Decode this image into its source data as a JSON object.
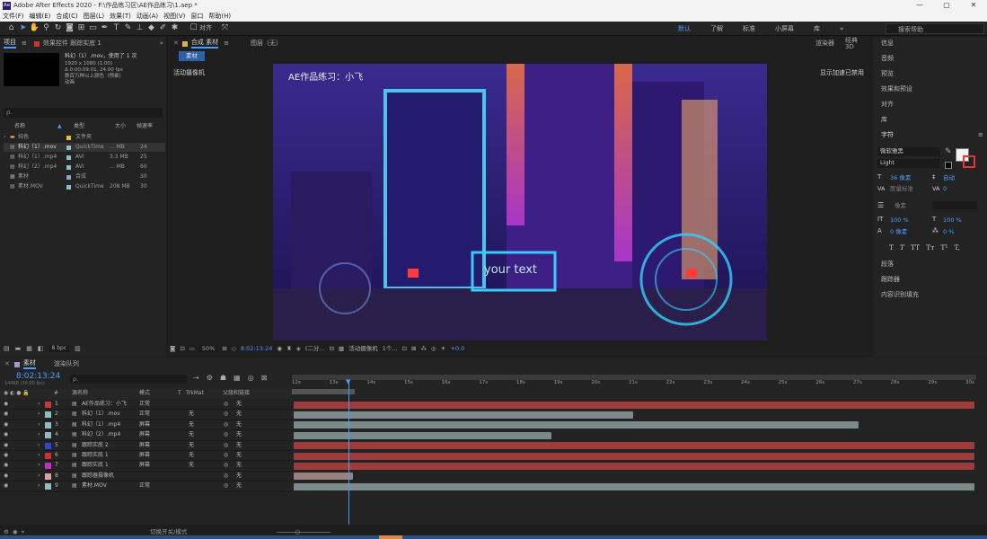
{
  "window": {
    "app_icon": "Ae",
    "title": "Adobe After Effects 2020 - F:\\作品练习区\\AE作品练习\\1.aep *",
    "minimize": "—",
    "maximize": "▢",
    "close": "✕"
  },
  "menu": [
    "文件(F)",
    "编辑(E)",
    "合成(C)",
    "图层(L)",
    "效果(T)",
    "动画(A)",
    "视图(V)",
    "窗口",
    "帮助(H)"
  ],
  "toolbar": {
    "align_label": "对齐",
    "workspaces": [
      "默认",
      "了解",
      "标准",
      "小屏幕",
      "库"
    ],
    "more": "»",
    "search_help": "搜索帮助"
  },
  "project": {
    "tab": "项目",
    "menu_icon": "≡",
    "effects_tab": "效果控件 跟踪实底 1",
    "expand": "»",
    "preview_name": "科幻（1）.mov",
    "used": "，使用了 1 次",
    "info_lines": [
      "1920 x 1080 (1.00)",
      "Δ 0:00:09:01, 24.00 fps",
      "数百万种以上颜色（预乘）",
      "动画"
    ],
    "search_placeholder": "ρ.",
    "col_name": "名称",
    "col_type": "类型",
    "col_size": "大小",
    "col_fps": "帧速率",
    "rows": [
      {
        "name": "纯色",
        "type": "文件夹",
        "size": "",
        "fps": ""
      },
      {
        "name": "科幻（1）.mov",
        "type": "QuickTime",
        "size": "... MB",
        "fps": "24"
      },
      {
        "name": "科幻（1）.mp4",
        "type": "AVI",
        "size": "3.3 MB",
        "fps": "25"
      },
      {
        "name": "科幻（2）.mp4",
        "type": "AVI",
        "size": "... MB",
        "fps": "60"
      },
      {
        "name": "素材",
        "type": "合成",
        "size": "",
        "fps": "30"
      },
      {
        "name": "素材.MOV",
        "type": "QuickTime",
        "size": "208 MB",
        "fps": "30"
      }
    ],
    "bpc": "8 bpc"
  },
  "comp": {
    "tab": "合成 素材",
    "menu_icon": "≡",
    "layer_tab": "图层（无）",
    "renderer_label": "渲染器",
    "renderer": "经典 3D",
    "breadcrumb": "素材",
    "camera": "活动摄像机",
    "gpu_note": "显示加速已禁用",
    "overlay_text": "AE作品练习：小飞",
    "sign_text": "your text",
    "zoom": "50%",
    "timecode": "8:02:13:24",
    "resolution": "(二分...",
    "view": "活动摄像机",
    "views": "1个...",
    "exposure": "+0.0"
  },
  "right": {
    "items": [
      "信息",
      "音频",
      "预览",
      "效果和预设",
      "对齐",
      "库"
    ],
    "char_title": "字符",
    "char_menu": "≡",
    "font": "微软雅黑",
    "style": "Light",
    "font_size": "36 像素",
    "leading": "自动",
    "kerning_label": "度量标准",
    "tracking": "0",
    "stroke_unit": "像素",
    "vscale": "100 %",
    "hscale": "100 %",
    "baseline": "0 像素",
    "tsume": "0 %",
    "styles": [
      "T",
      "T",
      "TT",
      "Tт",
      "T¹",
      "T,"
    ],
    "bottom_items": [
      "段落",
      "跟踪器",
      "内容识别填充"
    ]
  },
  "timeline": {
    "tab": "素材",
    "render_queue": "渲染队列",
    "timecode": "8:02:13:24",
    "fps_info": "14466 (30.00 fps)",
    "search_placeholder": "ρ.",
    "cols": {
      "num": "#",
      "name": "源名称",
      "mode": "模式",
      "t": "T",
      "trkmat": "TrkMat",
      "parent": "父级和链接"
    },
    "ticks": [
      "12s",
      "13s",
      "14s",
      "15s",
      "16s",
      "17s",
      "18s",
      "19s",
      "20s",
      "21s",
      "22s",
      "23s",
      "24s",
      "25s",
      "26s",
      "27s",
      "28s",
      "29s",
      "30s"
    ],
    "layers": [
      {
        "num": "1",
        "color": "#c23b3b",
        "name": "AE作品练习：小飞",
        "mode": "正常",
        "trk": "",
        "parent": "无",
        "bar_color": "#9e3b3b",
        "start": 0.0,
        "end": 1.0
      },
      {
        "num": "2",
        "color": "#8fbcbc",
        "name": "科幻（1）.mov",
        "mode": "正常",
        "trk": "无",
        "parent": "无",
        "bar_color": "#7d8a8a",
        "start": 0.0,
        "end": 0.5
      },
      {
        "num": "3",
        "color": "#8fbcbc",
        "name": "科幻（1）.mp4",
        "mode": "屏幕",
        "trk": "无",
        "parent": "无",
        "bar_color": "#7d8a8a",
        "start": 0.0,
        "end": 0.83
      },
      {
        "num": "4",
        "color": "#8fbcbc",
        "name": "科幻（2）.mp4",
        "mode": "屏幕",
        "trk": "无",
        "parent": "无",
        "bar_color": "#7d8a8a",
        "start": 0.0,
        "end": 0.38
      },
      {
        "num": "5",
        "color": "#3344cc",
        "name": "跟踪实底 2",
        "mode": "屏幕",
        "trk": "无",
        "parent": "无",
        "bar_color": "#9e3b3b",
        "start": 0.0,
        "end": 1.0
      },
      {
        "num": "6",
        "color": "#d03030",
        "name": "跟踪实底 1",
        "mode": "屏幕",
        "trk": "无",
        "parent": "无",
        "bar_color": "#9e3b3b",
        "start": 0.0,
        "end": 1.0
      },
      {
        "num": "7",
        "color": "#c030c0",
        "name": "跟踪实底 1",
        "mode": "屏幕",
        "trk": "无",
        "parent": "无",
        "bar_color": "#9e3b3b",
        "start": 0.0,
        "end": 1.0
      },
      {
        "num": "8",
        "color": "#e0a0a0",
        "name": "跟踪器摄像机",
        "mode": "",
        "trk": "",
        "parent": "无",
        "bar_color": "#9a7f7f",
        "start": 0.0,
        "end": 0.09
      },
      {
        "num": "9",
        "color": "#8fbcbc",
        "name": "素材.MOV",
        "mode": "正常",
        "trk": "",
        "parent": "无",
        "bar_color": "#7d8a8a",
        "start": 0.0,
        "end": 1.0
      }
    ],
    "toggle_label": "切换开关/模式"
  },
  "colors": {
    "accent": "#4a9cff",
    "panel": "#232323",
    "bg": "#1d1d1d"
  }
}
